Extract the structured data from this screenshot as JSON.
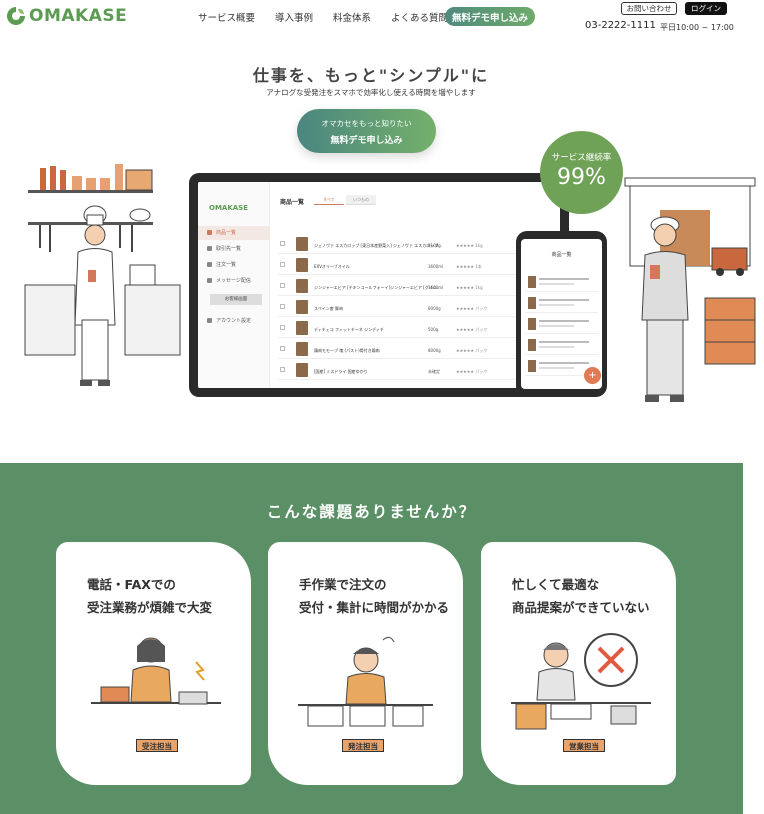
{
  "header": {
    "logo_text": "OMAKASE",
    "nav": [
      "サービス概要",
      "導入事例",
      "料金体系",
      "よくある質問"
    ],
    "cta": "無料デモ申し込み",
    "contact": "お問い合わせ",
    "login": "ログイン",
    "phone": "03-2222-1111",
    "hours": "平日10:00 ~ 17:00"
  },
  "hero": {
    "title": "仕事を、もっと\"シンプル\"に",
    "subtitle": "アナログな受発注をスマホで効率化し使える時間を増やします",
    "cta_line1": "オマカセをもっと知りたい",
    "cta_line2": "無料デモ申し込み",
    "badge_title": "サービス継続率",
    "badge_value": "99%"
  },
  "tablet": {
    "logo": "OMAKASE",
    "title": "商品一覧",
    "tabs": [
      "すべて",
      "いつもの"
    ],
    "menu": [
      "商品一覧",
      "取引先一覧",
      "注文一覧",
      "メッセージ配信",
      "お客様画面",
      "アカウント設定"
    ],
    "rows": [
      {
        "name": "ジェノヴァ エスカロップ [東日本産野菜入] ジェノヴァ エスカロップ…",
        "qty": "8100g",
        "stars": "★★★★★ 1kg"
      },
      {
        "name": "EXVオリーブオイル",
        "qty": "3600ml",
        "stars": "★★★★★ 1本"
      },
      {
        "name": "ジンジャーエビア [チキンコールフォーイ]ジンジャーエビア [グリル…",
        "qty": "3600ml",
        "stars": "★★★★★ 1kg"
      },
      {
        "name": "スペイン産 豚肉",
        "qty": "8000g",
        "stars": "★★★★★ パック"
      },
      {
        "name": "ディチェコ フィットチーネ ジンディチ",
        "qty": "500g",
        "stars": "★★★★★ パック"
      },
      {
        "name": "鶏肉モモ一ブ 塊 (パスト)骨付き鶏肉",
        "qty": "8000g",
        "stars": "★★★★★ パック"
      },
      {
        "name": "[国産] ミスドライ 国産ゆかり",
        "qty": "未確定",
        "stars": "★★★★★ パック"
      }
    ]
  },
  "phone": {
    "title": "商品一覧"
  },
  "problems": {
    "title": "こんな課題ありませんか？",
    "cards": [
      {
        "line1": "電話・FAXでの",
        "line2": "受注業務が煩雑で大変",
        "role": "受注担当"
      },
      {
        "line1": "手作業で注文の",
        "line2": "受付・集計に時間がかかる",
        "role": "発注担当"
      },
      {
        "line1": "忙しくて最適な",
        "line2": "商品提案ができていない",
        "role": "営業担当"
      }
    ]
  },
  "colors": {
    "brand_green": "#5c9b52",
    "section_green": "#5b8f65",
    "accent_orange": "#e07b56"
  }
}
